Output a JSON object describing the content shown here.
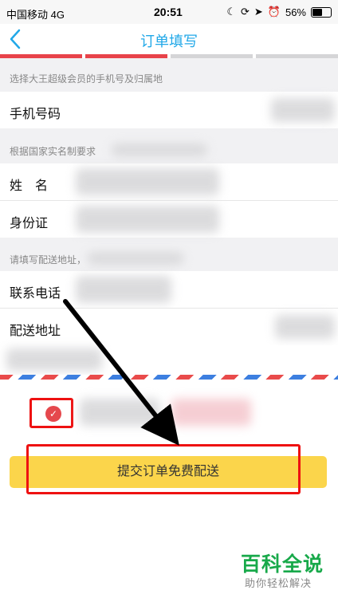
{
  "status_bar": {
    "carrier": "中国移动  4G",
    "time": "20:51",
    "battery": "56%"
  },
  "nav": {
    "title": "订单填写"
  },
  "progress": {
    "colors": [
      "#e8434a",
      "#e8434a",
      "#d5d5d7",
      "#d5d5d7"
    ]
  },
  "sections": {
    "phone_hint": "选择大王超级会员的手机号及归属地",
    "id_hint": "根据国家实名制要求",
    "address_hint": "请填写配送地址，"
  },
  "rows": {
    "phone": "手机号码",
    "name": "姓　名",
    "id_card": "身份证",
    "contact": "联系电话",
    "address": "配送地址"
  },
  "submit": {
    "label": "提交订单免费配送"
  },
  "watermark": {
    "main": "百科全说",
    "sub": "助你轻松解决"
  },
  "accent": {
    "brand": "#21a8e8",
    "button": "#fbd54b",
    "highlight": "#ee1111"
  }
}
